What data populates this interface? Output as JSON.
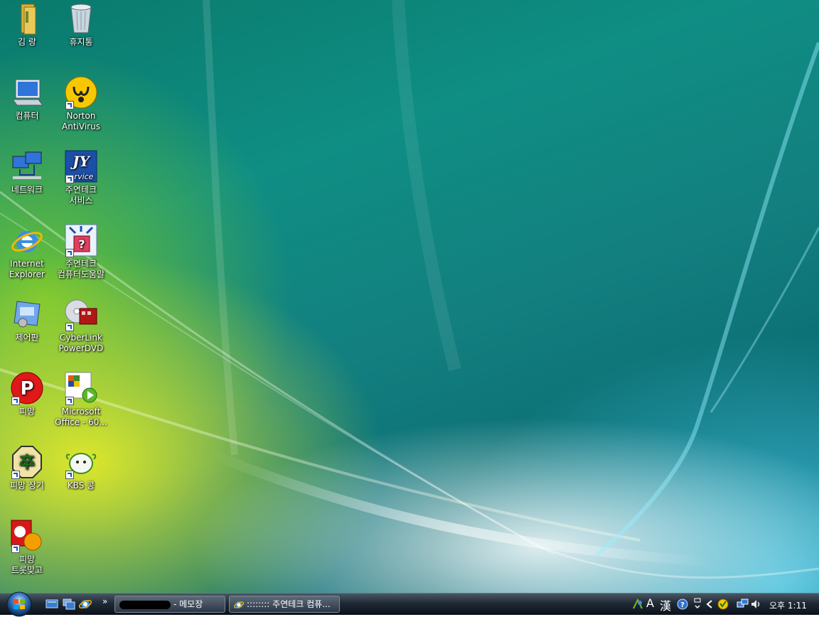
{
  "desktop": {
    "icons": [
      {
        "label": "김 랑",
        "icon": "folder-icon"
      },
      {
        "label": "휴지통",
        "icon": "recycle-bin-icon"
      },
      {
        "label": "컴퓨터",
        "icon": "computer-icon"
      },
      {
        "label": "Norton\nAntiVirus",
        "icon": "norton-icon"
      },
      {
        "label": "네트워크",
        "icon": "network-icon"
      },
      {
        "label": "주연테크\n서비스",
        "icon": "jservice-icon"
      },
      {
        "label": "Internet\nExplorer",
        "icon": "ie-icon"
      },
      {
        "label": "주연테크\n컴퓨터도움말",
        "icon": "help-icon"
      },
      {
        "label": "제어판",
        "icon": "control-panel-icon"
      },
      {
        "label": "CyberLink\nPowerDVD",
        "icon": "powerdvd-icon"
      },
      {
        "label": "피망",
        "icon": "pmang-icon"
      },
      {
        "label": "Microsoft\nOffice - 60...",
        "icon": "office-icon"
      },
      {
        "label": "피망 장기",
        "icon": "janggi-icon"
      },
      {
        "label": "KBS 콩",
        "icon": "kbs-kong-icon"
      },
      {
        "label": "피망\n트롯맞고",
        "icon": "gostop-icon"
      }
    ]
  },
  "taskbar": {
    "tasks": [
      {
        "label": "- 메모장"
      },
      {
        "label": ":::::::: 주연테크 컴퓨..."
      }
    ],
    "tray": {
      "ime_mode": "A",
      "ime_hanja": "漢",
      "clock": "오후 1:11"
    }
  },
  "colors": {
    "taskbar_top": "#4a5663",
    "taskbar_bottom": "#0b1119",
    "desktop_teal": "#0f8e84"
  }
}
